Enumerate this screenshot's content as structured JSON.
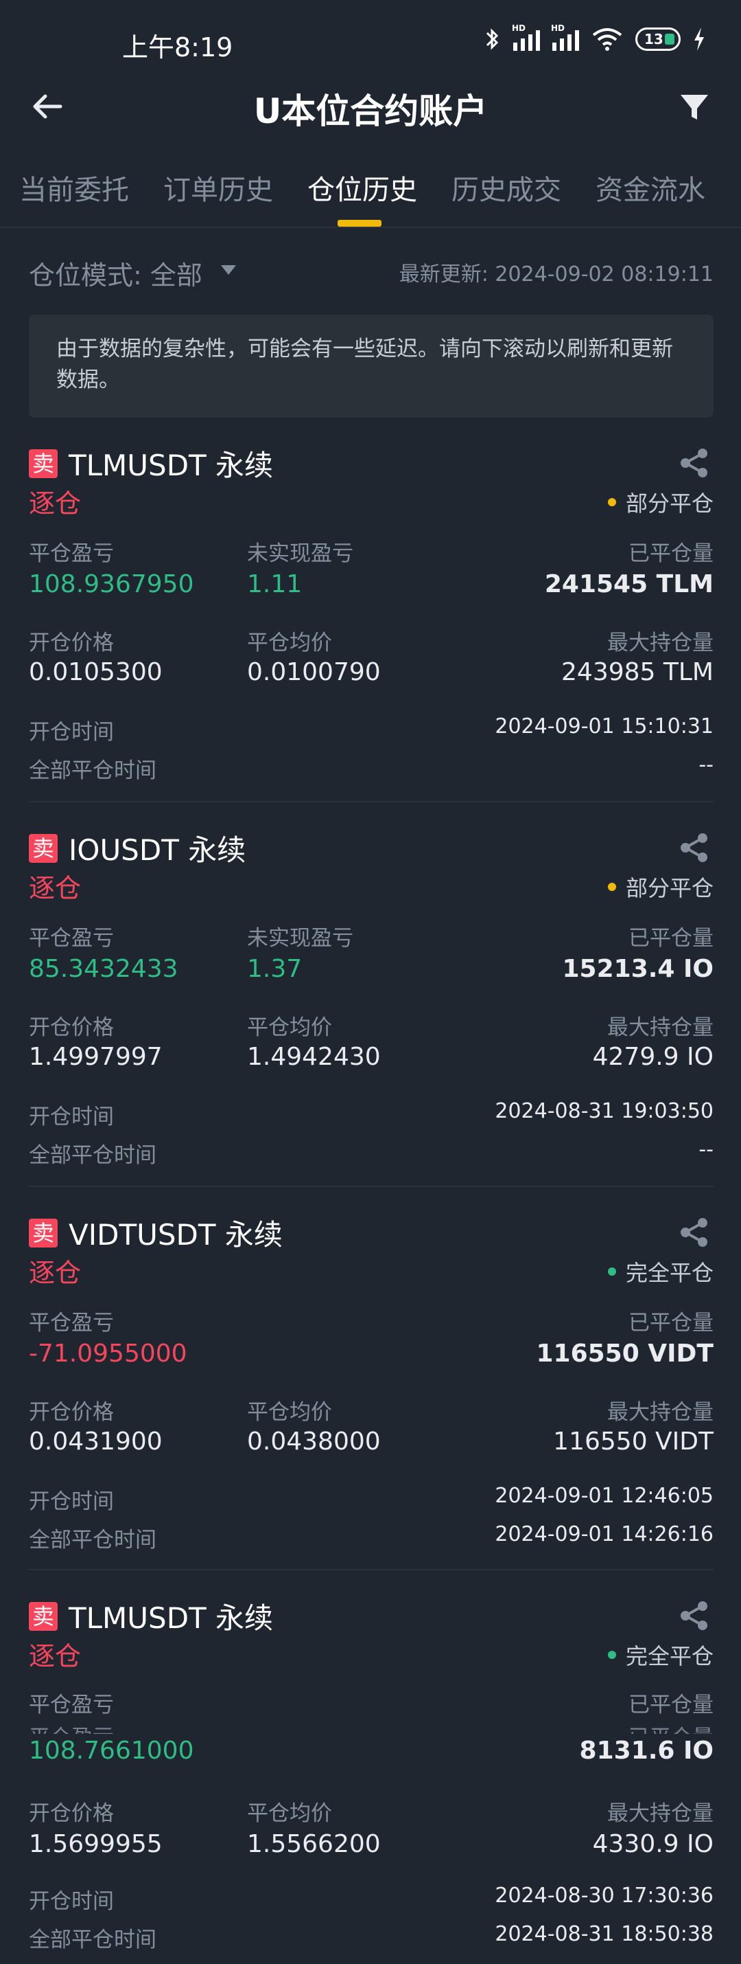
{
  "status": {
    "time": "上午8:19",
    "battery": "13",
    "hd1": "HD",
    "hd2": "HD"
  },
  "header": {
    "title": "U本位合约账户"
  },
  "tabs": [
    {
      "label": "当前委托"
    },
    {
      "label": "订单历史"
    },
    {
      "label": "仓位历史"
    },
    {
      "label": "历史成交"
    },
    {
      "label": "资金流水"
    }
  ],
  "filter": {
    "mode_label": "仓位模式: 全部",
    "updated": "最新更新: 2024-09-02 08:19:11"
  },
  "notice": "由于数据的复杂性，可能会有一些延迟。请向下滚动以刷新和更新数据。",
  "labels": {
    "close_pnl": "平仓盈亏",
    "unrealized_pnl": "未实现盈亏",
    "closed_qty": "已平仓量",
    "open_price": "开仓价格",
    "close_avg": "平仓均价",
    "max_position": "最大持仓量",
    "open_time": "开仓时间",
    "full_close_time": "全部平仓时间"
  },
  "positions": [
    {
      "side": "卖",
      "symbol": "TLMUSDT 永续",
      "margin_mode": "逐仓",
      "status": "部分平仓",
      "close_pnl": "108.9367950",
      "unrealized_pnl": "1.11",
      "closed_qty": "241545 TLM",
      "open_price": "0.0105300",
      "close_avg": "0.0100790",
      "max_position": "243985 TLM",
      "open_time": "2024-09-01 15:10:31",
      "full_close_time": "--"
    },
    {
      "side": "卖",
      "symbol": "IOUSDT 永续",
      "margin_mode": "逐仓",
      "status": "部分平仓",
      "close_pnl": "85.3432433",
      "unrealized_pnl": "1.37",
      "closed_qty": "15213.4 IO",
      "open_price": "1.4997997",
      "close_avg": "1.4942430",
      "max_position": "4279.9 IO",
      "open_time": "2024-08-31 19:03:50",
      "full_close_time": "--"
    },
    {
      "side": "卖",
      "symbol": "VIDTUSDT 永续",
      "margin_mode": "逐仓",
      "status": "完全平仓",
      "close_pnl": "-71.0955000",
      "closed_qty": "116550 VIDT",
      "open_price": "0.0431900",
      "close_avg": "0.0438000",
      "max_position": "116550 VIDT",
      "open_time": "2024-09-01 12:46:05",
      "full_close_time": "2024-09-01 14:26:16"
    },
    {
      "side": "卖",
      "symbol": "TLMUSDT 永续",
      "margin_mode": "逐仓",
      "status": "完全平仓",
      "close_pnl": "108.7661000",
      "closed_qty": "8131.6 IO",
      "open_price": "1.5699955",
      "close_avg": "1.5566200",
      "max_position": "4330.9 IO",
      "open_time": "2024-08-30 17:30:36",
      "full_close_time": "2024-08-31 18:50:38"
    }
  ],
  "colors": {
    "bg": "#1f2630",
    "positive": "#2ebd85",
    "negative": "#f6465d",
    "accent": "#f0b90b",
    "muted": "#848e9c"
  },
  "icons": {
    "back": "arrow-left-icon",
    "filter": "funnel-icon",
    "share": "share-icon",
    "bluetooth": "bluetooth-icon",
    "wifi": "wifi-icon",
    "charging": "bolt-icon"
  }
}
